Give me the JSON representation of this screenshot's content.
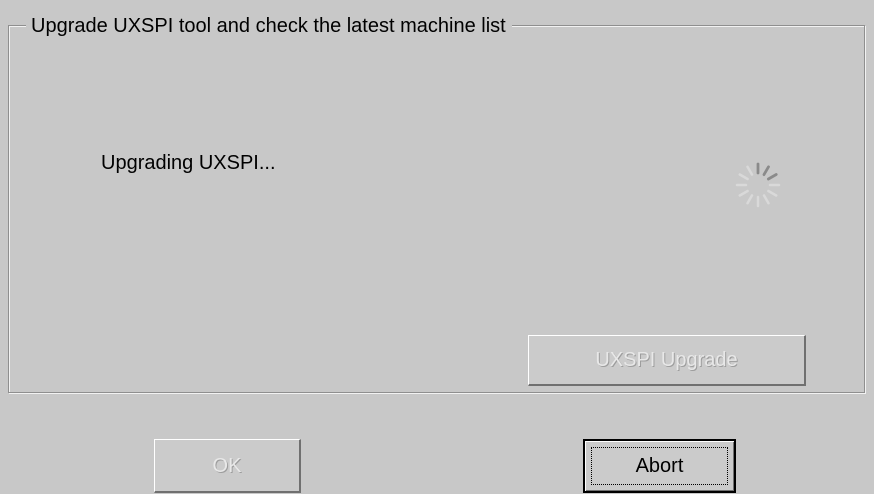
{
  "dialog": {
    "group_title": "Upgrade UXSPI tool and check the latest machine list",
    "status_text": "Upgrading UXSPI...",
    "spinner_icon": "loading-spinner-icon",
    "upgrade_button_label": "UXSPI Upgrade",
    "upgrade_button_enabled": false,
    "ok_button_label": "OK",
    "ok_button_enabled": false,
    "abort_button_label": "Abort",
    "abort_button_focused": true
  },
  "colors": {
    "background": "#c8c8c8",
    "disabled_text": "#e8e8e8",
    "spinner": "#d9d9d9"
  }
}
